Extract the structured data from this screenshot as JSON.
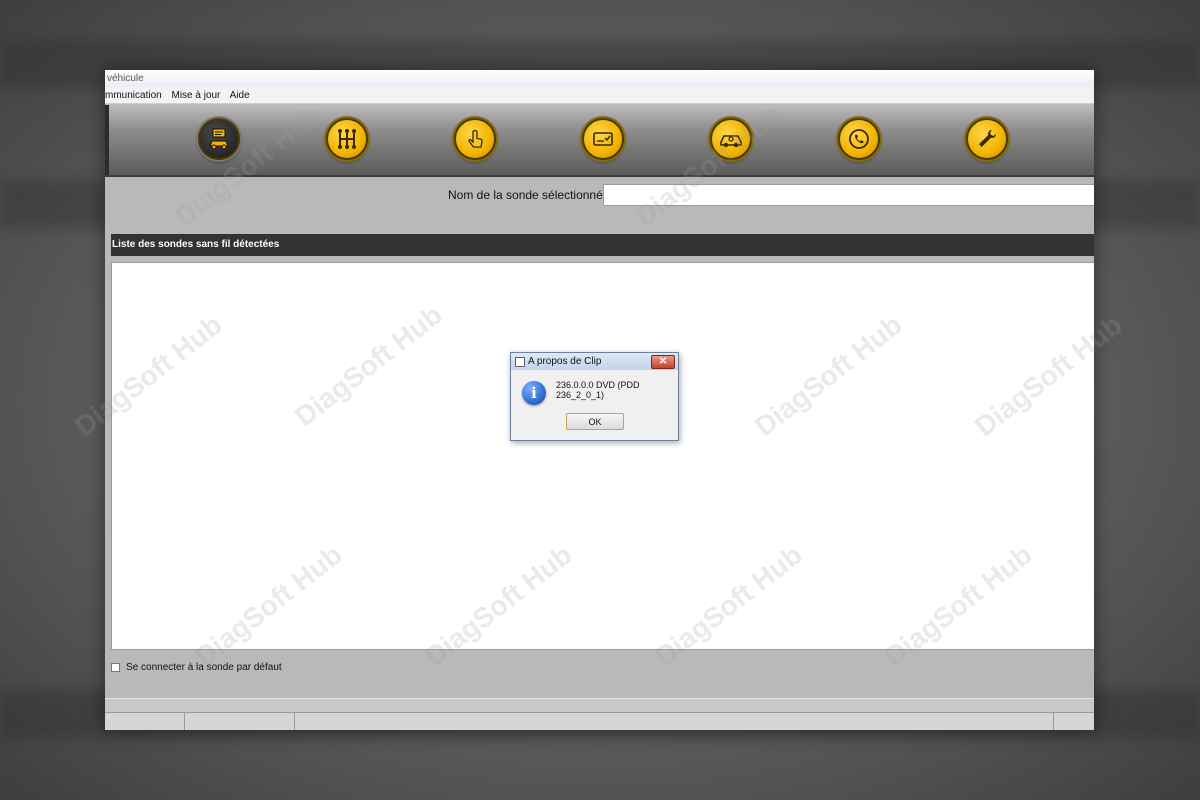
{
  "window": {
    "title_fragment": "véhicule"
  },
  "menubar": {
    "items": [
      {
        "label": "mmunication"
      },
      {
        "label": "Mise à jour"
      },
      {
        "label": "Aide"
      }
    ]
  },
  "toolbar": {
    "buttons": [
      {
        "icon": "vehicle-info-icon",
        "active": true
      },
      {
        "icon": "gearbox-icon",
        "active": false
      },
      {
        "icon": "touch-hand-icon",
        "active": false
      },
      {
        "icon": "card-icon",
        "active": false
      },
      {
        "icon": "car-check-icon",
        "active": false
      },
      {
        "icon": "phone-support-icon",
        "active": false
      },
      {
        "icon": "wrench-icon",
        "active": false
      }
    ],
    "accent_color": "#f2b400"
  },
  "probe_form": {
    "label": "Nom de la sonde sélectionnée",
    "value": ""
  },
  "probe_list": {
    "header": "Liste des sondes sans fil détectées",
    "items": []
  },
  "default_connect": {
    "label": "Se connecter à la sonde par défaut",
    "checked": false
  },
  "dialog": {
    "title": "A propos de Clip",
    "message": "236.0.0.0 DVD (PDD 236_2_0_1)",
    "ok_label": "OK",
    "close_glyph": "✕"
  },
  "watermark": {
    "text": "DiagSoft Hub"
  }
}
